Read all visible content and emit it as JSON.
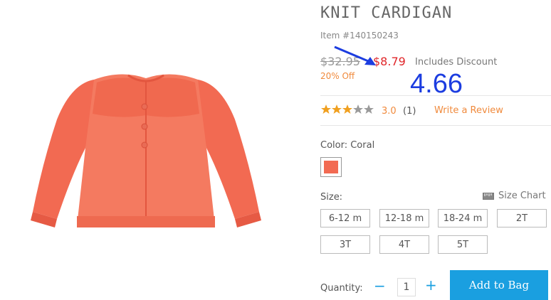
{
  "product": {
    "title": "KNIT CARDIGAN",
    "item_number": "Item #140150243",
    "image_alt": "Coral knit cardigan"
  },
  "price": {
    "original": "$32.95",
    "current": "$8.79",
    "discount_note": "Includes Discount",
    "percent_off": "20% Off"
  },
  "annotation": {
    "value": "4.66"
  },
  "rating": {
    "stars": 3.0,
    "value_text": "3.0",
    "count": "(1)",
    "write_review": "Write a Review"
  },
  "color": {
    "label": "Color: Coral",
    "swatch_hex": "#f26a52"
  },
  "size": {
    "label": "Size:",
    "chart_link": "Size Chart",
    "options": [
      "6-12 m",
      "12-18 m",
      "18-24 m",
      "2T",
      "3T",
      "4T",
      "5T"
    ]
  },
  "quantity": {
    "label": "Quantity:",
    "value": "1",
    "minus": "−",
    "plus": "+"
  },
  "cta": {
    "add_to_bag": "Add to Bag"
  },
  "colors": {
    "accent": "#1a9fe0",
    "sale": "#e0262a",
    "orange": "#f08a3c",
    "annotation": "#1c3de0"
  }
}
